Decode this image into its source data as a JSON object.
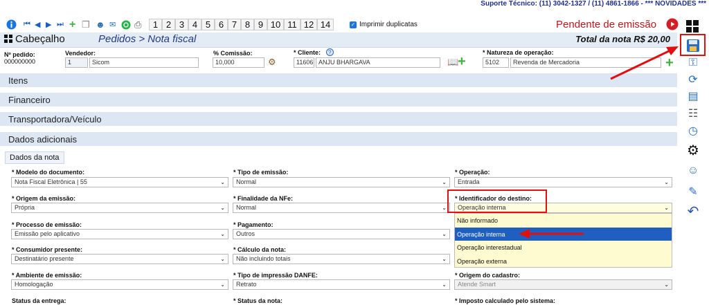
{
  "support_text": "Suporte Técnico: (11) 3042-1327 / (11) 4861-1866 - *** NOVIDADES ***",
  "toolbar": {
    "pages": [
      "1",
      "2",
      "3",
      "4",
      "5",
      "6",
      "7",
      "8",
      "9",
      "10",
      "11",
      "12",
      "14"
    ],
    "print_duplicates_label": "Imprimir duplicatas"
  },
  "status": "Pendente de emissão",
  "header": {
    "title": "Cabeçalho",
    "breadcrumb": "Pedidos > Nota fiscal",
    "total": "Total da nota R$ 20,00"
  },
  "order": {
    "number_label": "Nº pedido:",
    "number_value": "000000000",
    "seller_label": "Vendedor:",
    "seller_code": "1",
    "seller_name": "Sicom",
    "commission_label": "% Comissão:",
    "commission_value": "10,000",
    "client_label": "* Cliente:",
    "client_code": "11606",
    "client_name": "ANJU BHARGAVA",
    "nature_label": "* Natureza de operação:",
    "nature_code": "5102",
    "nature_name": "Revenda de Mercadoria"
  },
  "sections": [
    "Itens",
    "Financeiro",
    "Transportadora/Veículo",
    "Dados adicionais"
  ],
  "tab_label": "Dados da nota",
  "fields": {
    "modelo_label": "* Modelo do documento:",
    "modelo_value": "Nota Fiscal Eletrônica | 55",
    "tipo_emissao_label": "* Tipo de emissão:",
    "tipo_emissao_value": "Normal",
    "operacao_label": "* Operação:",
    "operacao_value": "Entrada",
    "origem_emissao_label": "* Origem da emissão:",
    "origem_emissao_value": "Própria",
    "finalidade_label": "* Finalidade da NFe:",
    "finalidade_value": "Normal",
    "identificador_label": "* Identificador do destino:",
    "identificador_value": "Operação interna",
    "processo_label": "* Processo de emissão:",
    "processo_value": "Emissão pelo aplicativo",
    "pagamento_label": "* Pagamento:",
    "pagamento_value": "Outros",
    "consumidor_label": "* Consumidor presente:",
    "consumidor_value": "Destinatário presente",
    "calculo_label": "* Cálculo da nota:",
    "calculo_value": "Não incluindo totais",
    "ambiente_label": "* Ambiente de emissão:",
    "ambiente_value": "Homologação",
    "danfe_label": "* Tipo de impressão DANFE:",
    "danfe_value": "Retrato",
    "origem_cadastro_label": "* Origem do cadastro:",
    "origem_cadastro_value": "Atende Smart",
    "status_entrega_label": "Status da entrega:",
    "status_nota_label": "* Status da nota:",
    "imposto_label": "* Imposto calculado pelo sistema:"
  },
  "dropdown_options": [
    "Não informado",
    "Operação interna",
    "Operação interestadual",
    "Operação externa"
  ],
  "selected_option_index": 1,
  "colors": {
    "accent": "#1f5fbf",
    "status_red": "#c0151b",
    "highlight_red": "#e01010",
    "section_bg": "#dde7f3"
  }
}
